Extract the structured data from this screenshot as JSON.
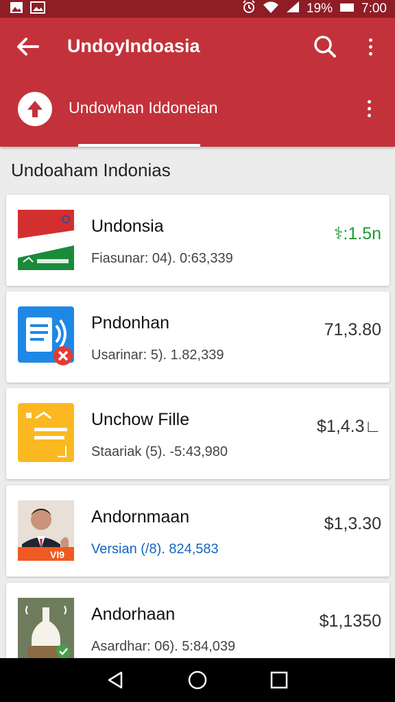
{
  "status_bar": {
    "battery_percent": "19%",
    "time": "7:00",
    "icons": [
      "image-icon",
      "photo-icon",
      "alarm-icon",
      "wifi-icon",
      "signal-icon",
      "battery-icon"
    ]
  },
  "app_bar": {
    "title": "UndoyIndoasia",
    "subtitle": "Undowhan Iddoneian",
    "color": "#c3323a",
    "status_color": "#8e1d25"
  },
  "section": {
    "title": "Undoaham Indonias"
  },
  "items": [
    {
      "title": "Undonsia",
      "subtitle": "Fiasunar: 04). 0:63,339",
      "price": "⚕:1.5n",
      "price_color": "#1e9a36",
      "thumb": "flag-app-icon"
    },
    {
      "title": "Pndonhan",
      "subtitle": "Usarinar: 5). 1.82,339",
      "price": "71,3.80",
      "thumb": "document-app-icon"
    },
    {
      "title": "Unchow Fille",
      "subtitle": "Staariak (5). -5:43,980",
      "price": "$1,4.3∟",
      "thumb": "file-app-icon"
    },
    {
      "title": "Andornmaan",
      "subtitle": "Versian (/8).  824,583",
      "price": "$1,3.30",
      "thumb": "person-photo-icon"
    },
    {
      "title": "Andorhaan",
      "subtitle": "Asardhar: 06). 5:84,039",
      "price": "$1,1350",
      "thumb": "bottle-app-icon"
    }
  ],
  "nav": {
    "icons": [
      "back-icon",
      "home-icon",
      "recents-icon"
    ]
  }
}
